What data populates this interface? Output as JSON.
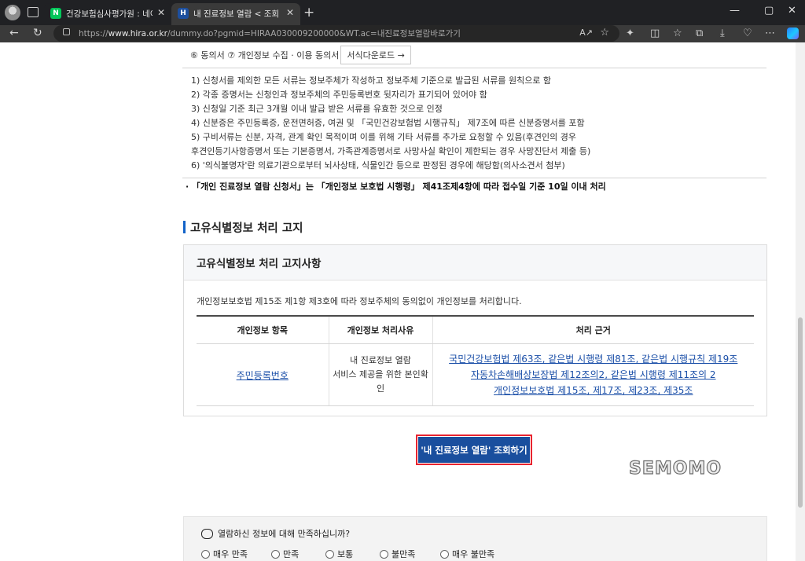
{
  "browser": {
    "tabs": [
      {
        "favicon": "N",
        "title": "건강보험심사평가원 : 네이버 검색",
        "active": false
      },
      {
        "favicon": "H",
        "title": "내 진료정보 열람 < 조회·신청 < 국민",
        "active": true
      }
    ],
    "url_prefix": "https://",
    "url_host": "www.hira.or.kr",
    "url_rest": "/dummy.do?pgmid=HIRAA030009200000&WT.ac=내진료정보열람바로가기",
    "reader_label": "A↗",
    "window_controls": [
      "—",
      "▢",
      "✕"
    ]
  },
  "forms": {
    "prefix": "⑥ 동의서 ⑦ 개인정보 수집 · 이용 동의서",
    "download_button": "서식다운로드 →"
  },
  "notes": [
    "1) 신청서를 제외한 모든 서류는 정보주체가 작성하고 정보주체 기준으로 발급된 서류를 원칙으로 함",
    "2) 각종 증명서는 신청인과 정보주체의 주민등록번호 뒷자리가 표기되어 있어야 함",
    "3) 신청일 기준 최근 3개월 이내 발급 받은 서류를 유효한 것으로 인정",
    "4) 신분증은 주민등록증, 운전면허증, 여권 및 「국민건강보험법 시행규칙」 제7조에 따른 신분증명서를 포함",
    "5) 구비서류는 신분, 자격, 관계 확인 목적이며 이를 위해 기타 서류를 추가로 요청할 수 있음(후견인의 경우",
    "후견인등기사항증명서 또는 기본증명서, 가족관계증명서로 사망사실 확인이 제한되는 경우 사망진단서 제출 등)",
    "6) '의식불명자'란 의료기관으로부터 뇌사상태, 식물인간 등으로 판정된 경우에 해당함(의사소견서 첨부)"
  ],
  "processing_note": "· 「개인 진료정보 열람 신청서」는 「개인정보 보호법 시행령」 제41조제4항에 따라 접수일 기준 10일 이내 처리",
  "section": {
    "title": "고유식별정보 처리 고지",
    "box_title": "고유식별정보 처리 고지사항",
    "description": "개인정보보호법 제15조 제1항 제3호에 따라 정보주체의 동의없이 개인정보를 처리합니다.",
    "table": {
      "headers": [
        "개인정보 항목",
        "개인정보 처리사유",
        "처리 근거"
      ],
      "item": "주민등록번호",
      "reason_lines": [
        "내 진료정보 열람",
        "서비스 제공을 위한 본인확",
        "인"
      ],
      "laws": [
        "국민건강보험법 제63조, 같은법 시행령 제81조, 같은법 시행규칙 제19조",
        "자동차손해배상보장법 제12조의2, 같은법 시행령 제11조의 2",
        "개인정보보호법 제15조, 제17조, 제23조, 제35조"
      ]
    }
  },
  "cta_button": "'내 진료정보 열람' 조회하기",
  "watermark": "SEMOMO",
  "survey": {
    "question": "열람하신 정보에 대해 만족하십니까?",
    "options": [
      "매우 만족",
      "만족",
      "보통",
      "불만족",
      "매우 불만족"
    ]
  },
  "colors": {
    "accent": "#1a4f9e",
    "highlight_border": "#e8232f",
    "link": "#1b4fa8",
    "section_bar": "#1262c8"
  }
}
